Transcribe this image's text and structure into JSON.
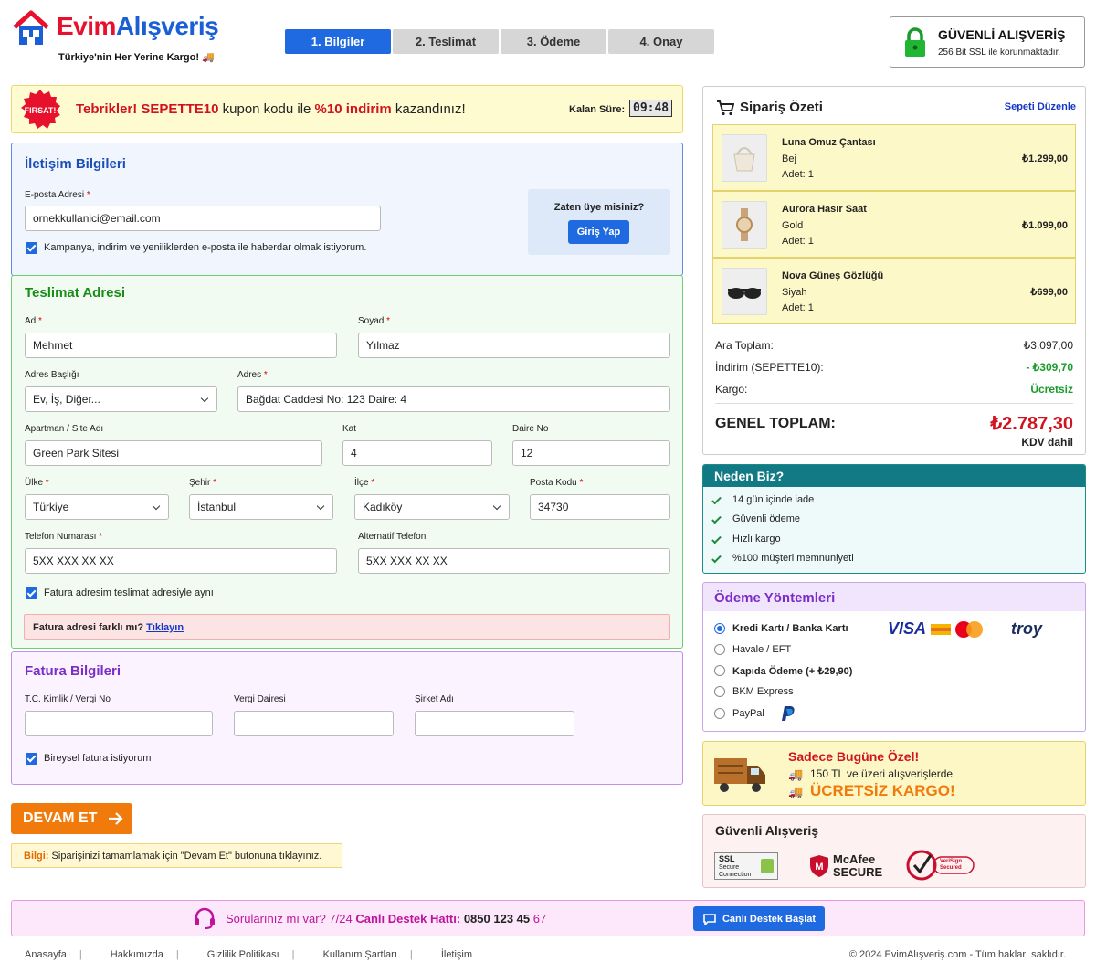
{
  "header": {
    "brand_part1": "Evim",
    "brand_part2": "Alışveriş",
    "tagline": "Türkiye'nin Her Yerine Kargo!",
    "steps": [
      "1. Bilgiler",
      "2. Teslimat",
      "3. Ödeme",
      "4. Onay"
    ],
    "secure_title": "GÜVENLİ ALIŞVERİŞ",
    "secure_sub": "256 Bit SSL ile korunmaktadır.",
    "colors": {
      "brand_red": "#e8112d",
      "brand_blue": "#1b5fd6",
      "active_step": "#1f6ae0"
    }
  },
  "coupon": {
    "badge": "FIRSAT!",
    "msg_prefix": "Tebrikler! ",
    "code": "SEPETTE10",
    "msg_mid": " kupon kodu ile ",
    "discount": "%10 indirim",
    "msg_suffix": " kazandınız!",
    "timer_label": "Kalan Süre:",
    "timer": "09:48"
  },
  "contact": {
    "title": "İletişim Bilgileri",
    "email_label": "E-posta Adresi",
    "email_value": "ornekkullanici@email.com",
    "newsletter_label": "Kampanya, indirim ve yeniliklerden e-posta ile haberdar olmak istiyorum.",
    "member_question": "Zaten üye misiniz?",
    "login_button": "Giriş Yap"
  },
  "shipping": {
    "title": "Teslimat Adresi",
    "first_name_label": "Ad",
    "first_name": "Mehmet",
    "last_name_label": "Soyad",
    "last_name": "Yılmaz",
    "addr_title_label": "Adres Başlığı",
    "addr_title": "Ev, İş, Diğer...",
    "address_label": "Adres",
    "address": "Bağdat Caddesi No: 123 Daire: 4",
    "building_label": "Apartman / Site Adı",
    "building": "Green Park Sitesi",
    "floor_label": "Kat",
    "floor": "4",
    "apt_label": "Daire No",
    "apt": "12",
    "country_label": "Ülke",
    "country": "Türkiye",
    "city_label": "Şehir",
    "city": "İstanbul",
    "district_label": "İlçe",
    "district": "Kadıköy",
    "zip_label": "Posta Kodu",
    "zip": "34730",
    "phone_label": "Telefon Numarası",
    "phone_placeholder": "5XX XXX XX XX",
    "alt_phone_label": "Alternatif Telefon",
    "alt_phone_placeholder": "5XX XXX XX XX",
    "same_billing_label": "Fatura adresim teslimat adresiyle aynı",
    "diff_billing_text": "Fatura adresi farklı mı?",
    "diff_billing_link": "Tıklayın"
  },
  "billing": {
    "title": "Fatura Bilgileri",
    "tc_label": "T.C. Kimlik / Vergi No",
    "tax_office_label": "Vergi Dairesi",
    "company_label": "Şirket Adı",
    "individual_label": "Bireysel fatura istiyorum"
  },
  "actions": {
    "continue": "DEVAM ET",
    "info_prefix": "Bilgi:",
    "info_text": " Siparişinizi tamamlamak için \"Devam Et\" butonuna tıklayınız."
  },
  "summary": {
    "title": "Sipariş Özeti",
    "edit": "Sepeti Düzenle",
    "products": [
      {
        "name": "Luna Omuz Çantası",
        "variant": "Bej",
        "qty": "Adet: 1",
        "price": "₺1.299,00"
      },
      {
        "name": "Aurora Hasır Saat",
        "variant": "Gold",
        "qty": "Adet: 1",
        "price": "₺1.099,00"
      },
      {
        "name": "Nova Güneş Gözlüğü",
        "variant": "Siyah",
        "qty": "Adet: 1",
        "price": "₺699,00"
      }
    ],
    "subtotal_label": "Ara Toplam:",
    "subtotal": "₺3.097,00",
    "discount_label": "İndirim (SEPETTE10):",
    "discount": "- ₺309,70",
    "shipping_label": "Kargo:",
    "shipping": "Ücretsiz",
    "total_label": "GENEL TOPLAM:",
    "total": "₺2.787,30",
    "vat": "KDV dahil"
  },
  "why": {
    "title": "Neden Biz?",
    "items": [
      "14 gün içinde iade",
      "Güvenli ödeme",
      "Hızlı kargo",
      "%100 müşteri memnuniyeti"
    ]
  },
  "payment": {
    "title": "Ödeme Yöntemleri",
    "options": [
      "Kredi Kartı / Banka Kartı",
      "Havale / EFT",
      "Kapıda Ödeme (+ ₺29,90)",
      "BKM Express",
      "PayPal"
    ],
    "selected": "Kredi Kartı / Banka Kartı",
    "visa": "VISA",
    "troy": "troy"
  },
  "special": {
    "title": "Sadece Bugüne Özel!",
    "line1": "150 TL ve üzeri alışverişlerde",
    "line2": "ÜCRETSİZ KARGO!"
  },
  "trust": {
    "title": "Güvenli Alışveriş",
    "ssl": "SSL",
    "ssl_sub1": "Secure",
    "ssl_sub2": "Connection",
    "mcafee1": "McAfee",
    "mcafee2": "SECURE",
    "verisign1": "VeriSign",
    "verisign2": "Secured"
  },
  "support": {
    "question": "Sorularınız mı var? 7/24 ",
    "line_label": "Canlı Destek Hattı:",
    "phone_main": " 0850 123 45 ",
    "phone_end": "67",
    "button": "Canlı Destek Başlat"
  },
  "footer": {
    "links": [
      "Anasayfa",
      "Hakkımızda",
      "Gizlilik Politikası",
      "Kullanım Şartları",
      "İletişim"
    ],
    "copyright": "© 2024 EvimAlışveriş.com - Tüm hakları saklıdır."
  }
}
